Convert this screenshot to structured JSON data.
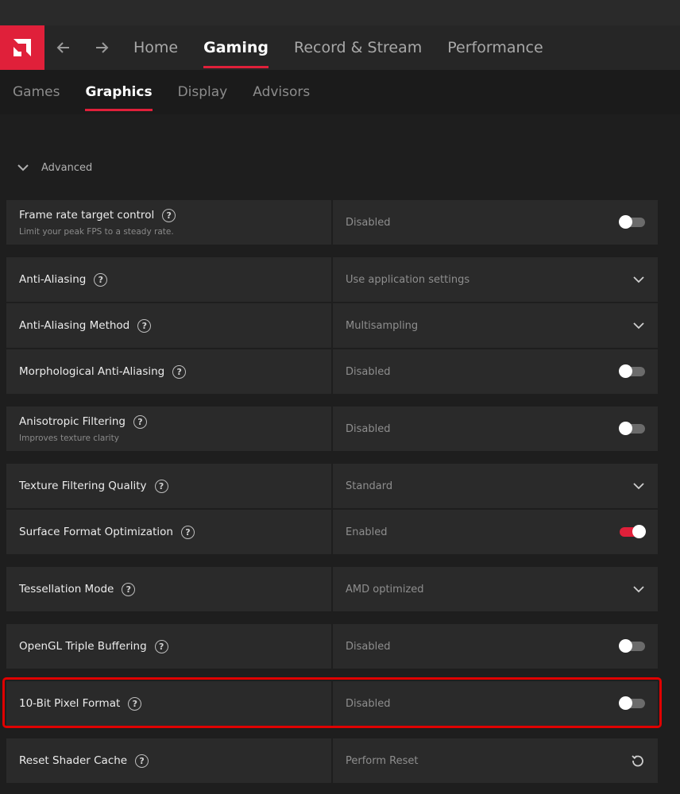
{
  "nav": {
    "items": [
      {
        "label": "Home",
        "active": false
      },
      {
        "label": "Gaming",
        "active": true
      },
      {
        "label": "Record & Stream",
        "active": false
      },
      {
        "label": "Performance",
        "active": false
      }
    ]
  },
  "subnav": {
    "items": [
      {
        "label": "Games",
        "active": false
      },
      {
        "label": "Graphics",
        "active": true
      },
      {
        "label": "Display",
        "active": false
      },
      {
        "label": "Advisors",
        "active": false
      }
    ]
  },
  "section": {
    "title": "Advanced"
  },
  "settings": [
    {
      "label": "Frame rate target control",
      "sublabel": "Limit your peak FPS to a steady rate.",
      "value": "Disabled",
      "control": "toggle",
      "on": false
    },
    {
      "label": "Anti-Aliasing",
      "sublabel": "",
      "value": "Use application settings",
      "control": "dropdown"
    },
    {
      "label": "Anti-Aliasing Method",
      "sublabel": "",
      "value": "Multisampling",
      "control": "dropdown"
    },
    {
      "label": "Morphological Anti-Aliasing",
      "sublabel": "",
      "value": "Disabled",
      "control": "toggle",
      "on": false
    },
    {
      "label": "Anisotropic Filtering",
      "sublabel": "Improves texture clarity",
      "value": "Disabled",
      "control": "toggle",
      "on": false
    },
    {
      "label": "Texture Filtering Quality",
      "sublabel": "",
      "value": "Standard",
      "control": "dropdown"
    },
    {
      "label": "Surface Format Optimization",
      "sublabel": "",
      "value": "Enabled",
      "control": "toggle",
      "on": true
    },
    {
      "label": "Tessellation Mode",
      "sublabel": "",
      "value": "AMD optimized",
      "control": "dropdown"
    },
    {
      "label": "OpenGL Triple Buffering",
      "sublabel": "",
      "value": "Disabled",
      "control": "toggle",
      "on": false
    },
    {
      "label": "10-Bit Pixel Format",
      "sublabel": "",
      "value": "Disabled",
      "control": "toggle",
      "on": false
    },
    {
      "label": "Reset Shader Cache",
      "sublabel": "",
      "value": "Perform Reset",
      "control": "reset"
    }
  ],
  "colors": {
    "accent": "#e0203a",
    "highlight": "#e00000"
  },
  "icons": {
    "logo": "amd-logo-icon",
    "back": "back-arrow-icon",
    "forward": "forward-arrow-icon",
    "help": "help-icon",
    "chevron": "chevron-down-icon",
    "reset": "reset-icon"
  }
}
